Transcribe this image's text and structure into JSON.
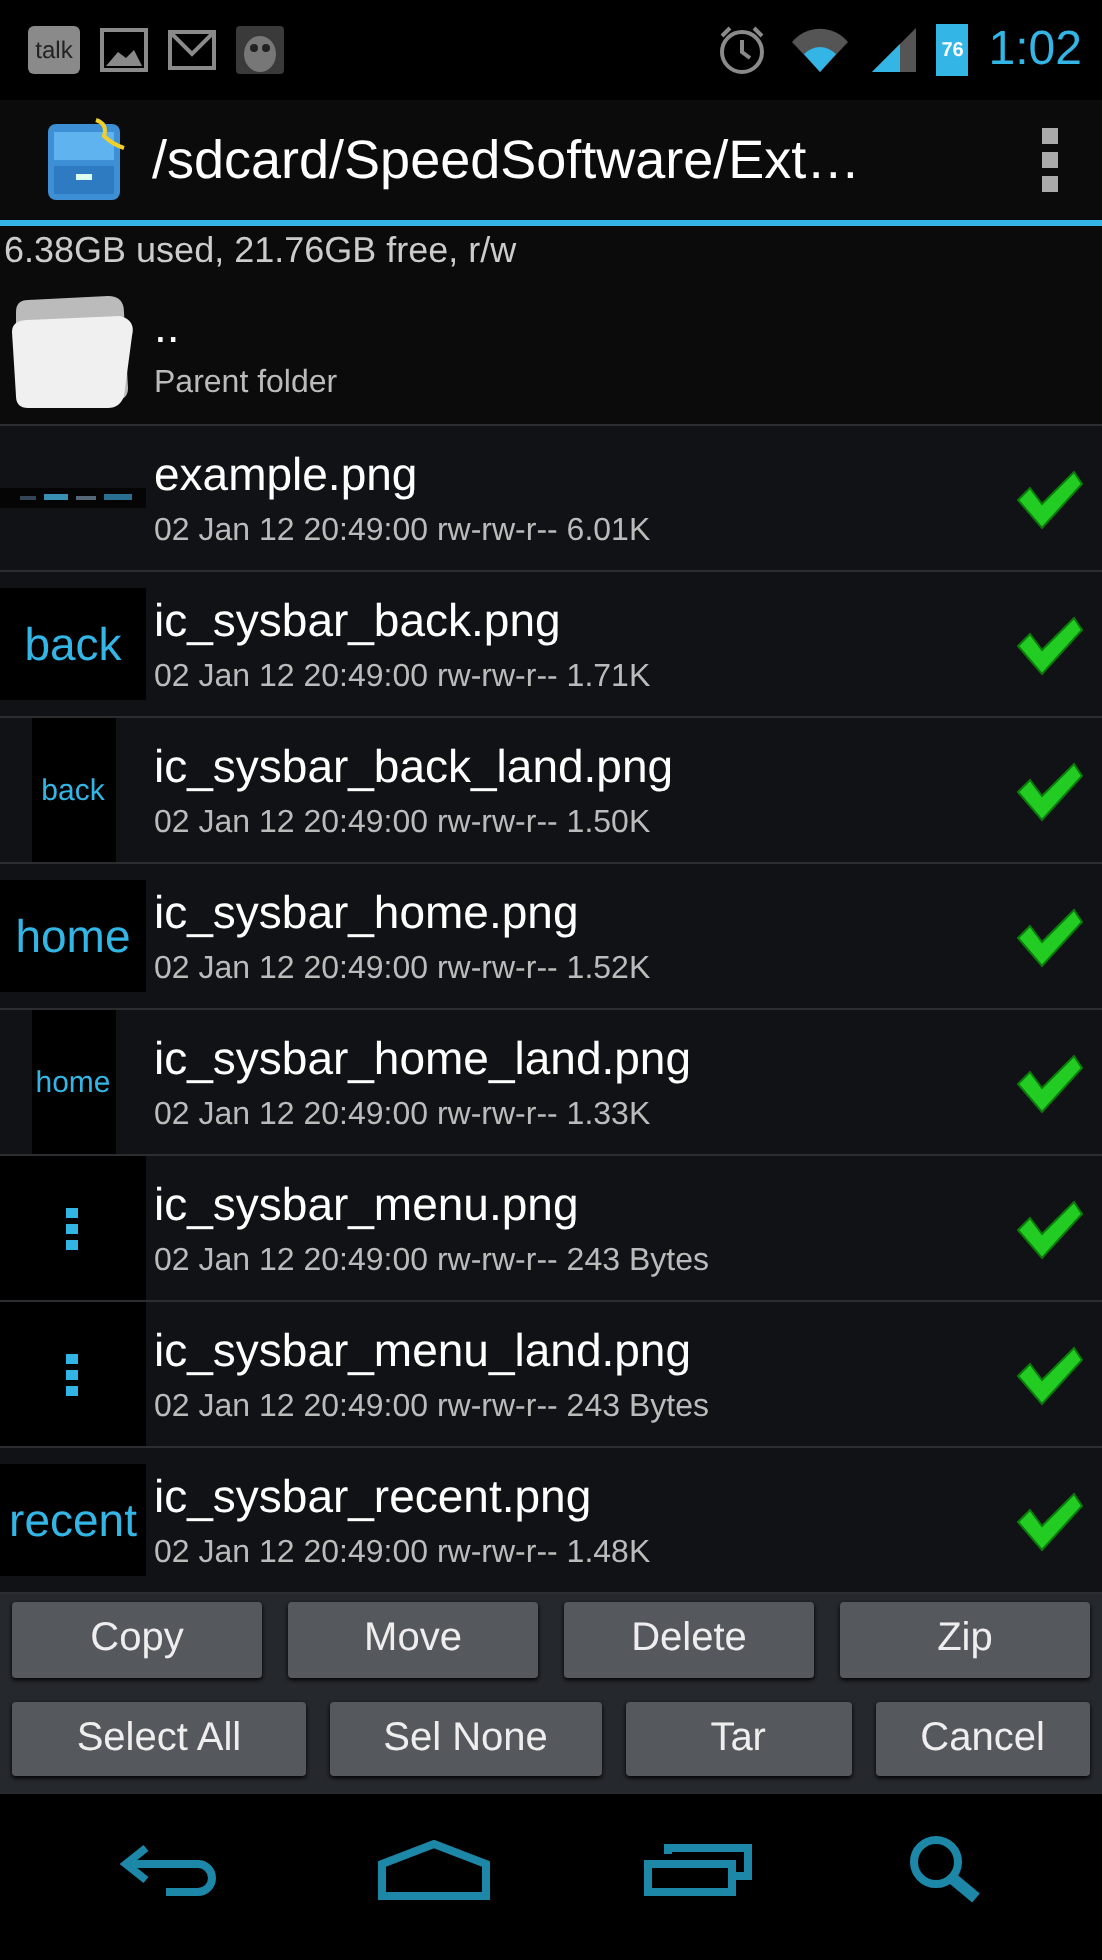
{
  "status_bar": {
    "notifications": [
      {
        "kind": "talk",
        "text": "talk"
      },
      {
        "kind": "gallery"
      },
      {
        "kind": "mail"
      },
      {
        "kind": "owl"
      }
    ],
    "battery": "76",
    "time": "1:02"
  },
  "action_bar": {
    "title": "/sdcard/SpeedSoftware/Ext…"
  },
  "storage_info": "6.38GB used, 21.76GB free, r/w",
  "files": [
    {
      "kind": "folder",
      "name": "..",
      "detail": "Parent folder"
    },
    {
      "kind": "file",
      "thumb": {
        "kind": "strip"
      },
      "name": "example.png",
      "date": "02 Jan 12 20:49:00",
      "perms": "rw-rw-r--",
      "size": "6.01K",
      "checked": true
    },
    {
      "kind": "file",
      "thumb": {
        "kind": "wide",
        "text": "back"
      },
      "name": "ic_sysbar_back.png",
      "date": "02 Jan 12 20:49:00",
      "perms": "rw-rw-r--",
      "size": "1.71K",
      "checked": true
    },
    {
      "kind": "file",
      "thumb": {
        "kind": "narrow",
        "text": "back"
      },
      "name": "ic_sysbar_back_land.png",
      "date": "02 Jan 12 20:49:00",
      "perms": "rw-rw-r--",
      "size": "1.50K",
      "checked": true
    },
    {
      "kind": "file",
      "thumb": {
        "kind": "wide",
        "text": "home"
      },
      "name": "ic_sysbar_home.png",
      "date": "02 Jan 12 20:49:00",
      "perms": "rw-rw-r--",
      "size": "1.52K",
      "checked": true
    },
    {
      "kind": "file",
      "thumb": {
        "kind": "narrow",
        "text": "home"
      },
      "name": "ic_sysbar_home_land.png",
      "date": "02 Jan 12 20:49:00",
      "perms": "rw-rw-r--",
      "size": "1.33K",
      "checked": true
    },
    {
      "kind": "file",
      "thumb": {
        "kind": "dots"
      },
      "name": "ic_sysbar_menu.png",
      "date": "02 Jan 12 20:49:00",
      "perms": "rw-rw-r--",
      "size": "243 Bytes",
      "checked": true
    },
    {
      "kind": "file",
      "thumb": {
        "kind": "dots"
      },
      "name": "ic_sysbar_menu_land.png",
      "date": "02 Jan 12 20:49:00",
      "perms": "rw-rw-r--",
      "size": "243 Bytes",
      "checked": true
    },
    {
      "kind": "file",
      "thumb": {
        "kind": "wide",
        "text": "recent"
      },
      "name": "ic_sysbar_recent.png",
      "date": "02 Jan 12 20:49:00",
      "perms": "rw-rw-r--",
      "size": "1.48K",
      "checked": true
    }
  ],
  "buttons": [
    [
      "Copy",
      "Move",
      "Delete",
      "Zip"
    ],
    [
      "Select All",
      "Sel None",
      "Tar",
      "Cancel"
    ]
  ],
  "nav_bar": [
    {
      "kind": "back"
    },
    {
      "kind": "home"
    },
    {
      "kind": "recents"
    },
    {
      "kind": "search"
    }
  ]
}
